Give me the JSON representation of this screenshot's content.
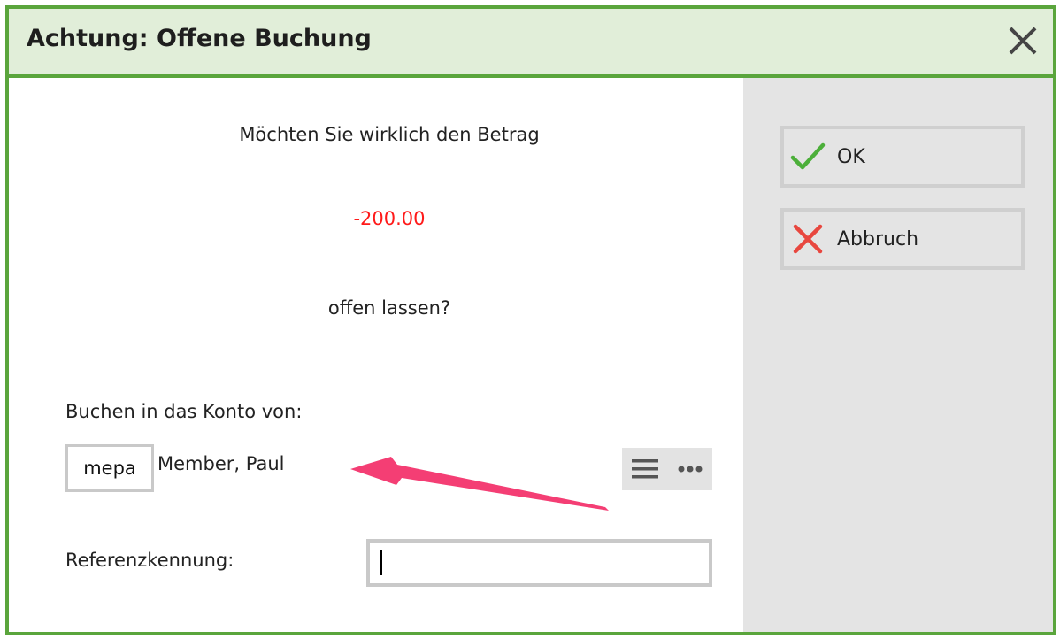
{
  "window": {
    "title": "Achtung: Offene Buchung"
  },
  "message": {
    "line1": "Möchten Sie wirklich den Betrag",
    "amount": "-200.00",
    "line2": "offen lassen?"
  },
  "account": {
    "label": "Buchen in das Konto von:",
    "code": "mepa",
    "name": "Member, Paul"
  },
  "reference": {
    "label": "Referenzkennung:",
    "value": ""
  },
  "buttons": {
    "ok": "OK",
    "cancel": "Abbruch"
  },
  "icons": {
    "close": "close-icon",
    "list": "list-icon",
    "more": "more-icon",
    "ok": "checkmark-icon",
    "cancel": "cross-icon",
    "annotation": "arrow-icon"
  },
  "colors": {
    "frame": "#5aa53c",
    "titlebar": "#e1eed9",
    "amount": "#ff1a1a",
    "sidebar": "#e4e4e4",
    "annotation_arrow": "#f43e74",
    "ok_check": "#4caf3a",
    "cancel_cross": "#e8473f"
  }
}
